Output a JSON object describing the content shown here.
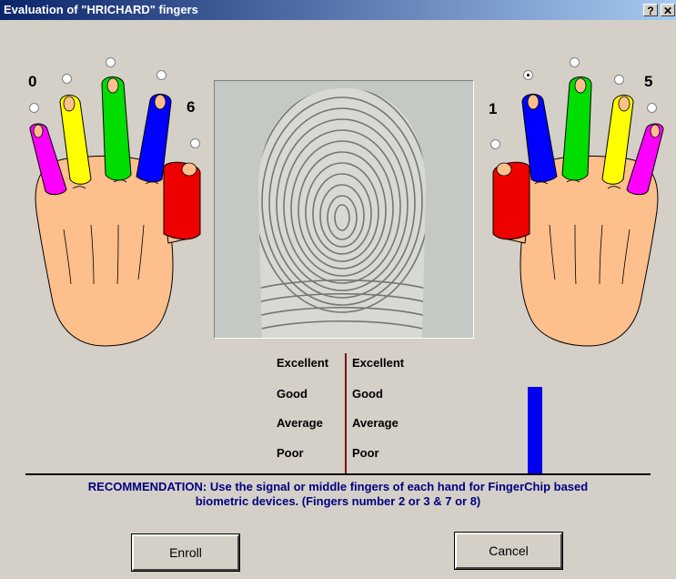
{
  "window": {
    "title": "Evaluation of \"HRICHARD\" fingers",
    "help_glyph": "?",
    "close_glyph": "✕"
  },
  "left_hand": {
    "labels": [
      "0",
      "6"
    ],
    "finger_colors": [
      "#ff00ff",
      "#ffff00",
      "#00dd00",
      "#0000ff",
      "#ee0000"
    ]
  },
  "right_hand": {
    "labels": [
      "1",
      "5"
    ],
    "finger_colors": [
      "#ee0000",
      "#0000ff",
      "#00dd00",
      "#ffff00",
      "#ff00ff"
    ]
  },
  "finger_selection": {
    "selected": "right-index"
  },
  "quality": {
    "left_scale": [
      "Excellent",
      "Good",
      "Average",
      "Poor"
    ],
    "right_scale": [
      "Excellent",
      "Good",
      "Average",
      "Poor"
    ],
    "bar_level": "Good",
    "bar_color": "#0000ee"
  },
  "recommendation": {
    "line1": "RECOMMENDATION: Use the signal or middle fingers of each hand for FingerChip based",
    "line2": "biometric devices. (Fingers number 2 or 3 & 7 or 8)"
  },
  "buttons": {
    "enroll": "Enroll",
    "cancel": "Cancel"
  },
  "colors": {
    "title_gradient_start": "#0a246a",
    "title_gradient_end": "#a6caf0",
    "dialog_bg": "#d4d0c8",
    "skin": "#fdbf8c",
    "divider": "#7a1010",
    "recommendation_text": "#000080"
  }
}
